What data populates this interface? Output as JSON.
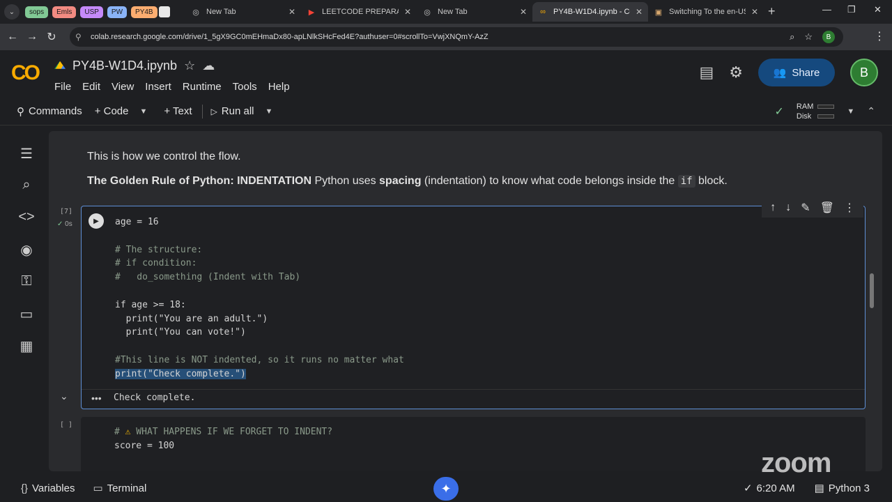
{
  "browser": {
    "menu_glyph": "⌄",
    "groups": [
      {
        "label": "sops",
        "color": "#81c995"
      },
      {
        "label": "Emls",
        "color": "#f28b82"
      },
      {
        "label": "USP",
        "color": "#c58af9"
      },
      {
        "label": "PW",
        "color": "#8ab4f8"
      },
      {
        "label": "PY4B",
        "color": "#fcad70"
      }
    ],
    "tabs": [
      {
        "title": "New Tab",
        "icon": "globe-icon"
      },
      {
        "title": "LEETCODE PREPARATIO",
        "icon": "youtube-icon"
      },
      {
        "title": "New Tab",
        "icon": "globe-icon"
      },
      {
        "title": "PY4B-W1D4.ipynb - Co",
        "icon": "colab-icon"
      },
      {
        "title": "Switching To the en-US",
        "icon": "page-icon"
      }
    ],
    "url": "colab.research.google.com/drive/1_5gX9GC0mEHmaDx80-apLNlkSHcFed4E?authuser=0#scrollTo=VwjXNQmY-AzZ",
    "profile_initial": "B"
  },
  "colab": {
    "logo": "CO",
    "notebook_title": "PY4B-W1D4.ipynb",
    "menu": [
      "File",
      "Edit",
      "View",
      "Insert",
      "Runtime",
      "Tools",
      "Help"
    ],
    "share_label": "Share",
    "avatar_initial": "B"
  },
  "toolbar": {
    "commands": "Commands",
    "code": "+ Code",
    "text": "+ Text",
    "run_all": "Run all",
    "ram": "RAM",
    "disk": "Disk"
  },
  "text_cell": {
    "line1": "This is how we control the flow.",
    "bold1": "The Golden Rule of Python: INDENTATION",
    "part2": " Python uses ",
    "bold2": "spacing",
    "part3": " (indentation) to know what code belongs inside the ",
    "code": "if",
    "part4": " block."
  },
  "cell1": {
    "exec_count": "[7]",
    "exec_time": "0s",
    "lines": [
      "age = 16",
      "",
      "# The structure:",
      "# if condition:",
      "#   do_something (Indent with Tab)",
      "",
      "if age >= 18:",
      "  print(\"You are an adult.\")",
      "  print(\"You can vote!\")",
      "",
      "#This line is NOT indented, so it runs no matter what",
      "print(\"Check complete.\")"
    ],
    "output": "Check complete."
  },
  "cell2": {
    "exec_count": "[ ]",
    "line1_prefix": "# ",
    "line1_text": " WHAT HAPPENS IF WE FORGET TO INDENT?",
    "line2": "score = 100"
  },
  "watermark": "zoom",
  "statusbar": {
    "variables": "Variables",
    "terminal": "Terminal",
    "time": "6:20 AM",
    "kernel": "Python 3"
  }
}
